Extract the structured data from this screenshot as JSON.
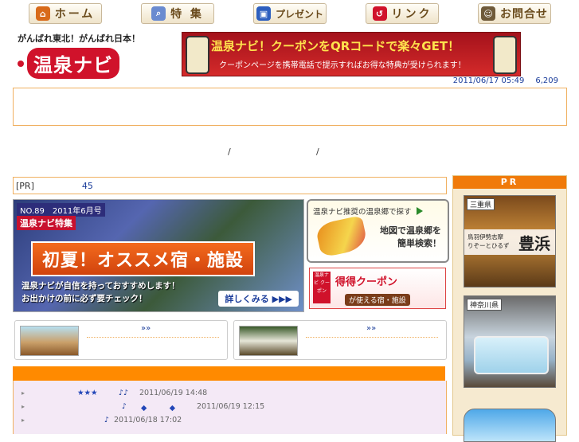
{
  "nav": {
    "home": "ホーム",
    "special": "特 集",
    "present": "プレゼント",
    "link": "リンク",
    "contact": "お問合せ"
  },
  "header": {
    "slogan": "がんばれ東北！がんばれ日本！",
    "logo_text": "温泉ナビ",
    "qr_banner_title": "温泉ナビ！クーポンをQRコードで楽々GET！",
    "qr_banner_sub": "クーポンページを携帯電話で提示すればお得な特典が受けられます！",
    "datetime": "2011/06/17 05:49",
    "count": "6,209"
  },
  "slashes": [
    "/",
    "/"
  ],
  "pr_line": {
    "tag": "[PR]",
    "number": "45"
  },
  "feature": {
    "issue": "NO.89　2011年6月号",
    "special": "温泉ナビ特集",
    "title": "初夏！オススメ宿・施設",
    "desc_1": "温泉ナビが自信を持っておすすめします！",
    "desc_2": "お出かけの前に必ず要チェック！",
    "more": "詳しくみる ▶▶▶"
  },
  "map_banner": {
    "header": "温泉ナビ推奨の温泉郷で探す",
    "copy_1": "地図で温泉郷を",
    "copy_2": "簡単検索！"
  },
  "coupon_banner": {
    "left": "温泉ナビ クーポン",
    "big": "得得クーポン",
    "small": "が使える宿・施設"
  },
  "cards": [
    {
      "more": "»»"
    },
    {
      "more": "»»"
    }
  ],
  "news": [
    {
      "stars": "★★★",
      "note": "♪♪",
      "date": "2011/06/19 14:48"
    },
    {
      "stars": "♪",
      "note": "◆　　　◆",
      "date": "2011/06/19 12:15"
    },
    {
      "stars": "",
      "note": "♪",
      "date": "2011/06/18 17:02"
    }
  ],
  "pr_col": {
    "head": "PR",
    "ad1_pref": "三重県",
    "ad1_area": "鳥羽伊勢志摩",
    "ad1_sub": "りぞーとひるず",
    "ad1_name": "豊浜",
    "ad2_pref": "神奈川県"
  },
  "colors": {
    "accent_orange": "#ff8a00",
    "border_orange": "#f0b060",
    "brand_red": "#d0122b",
    "link_blue": "#1a3c9a"
  }
}
